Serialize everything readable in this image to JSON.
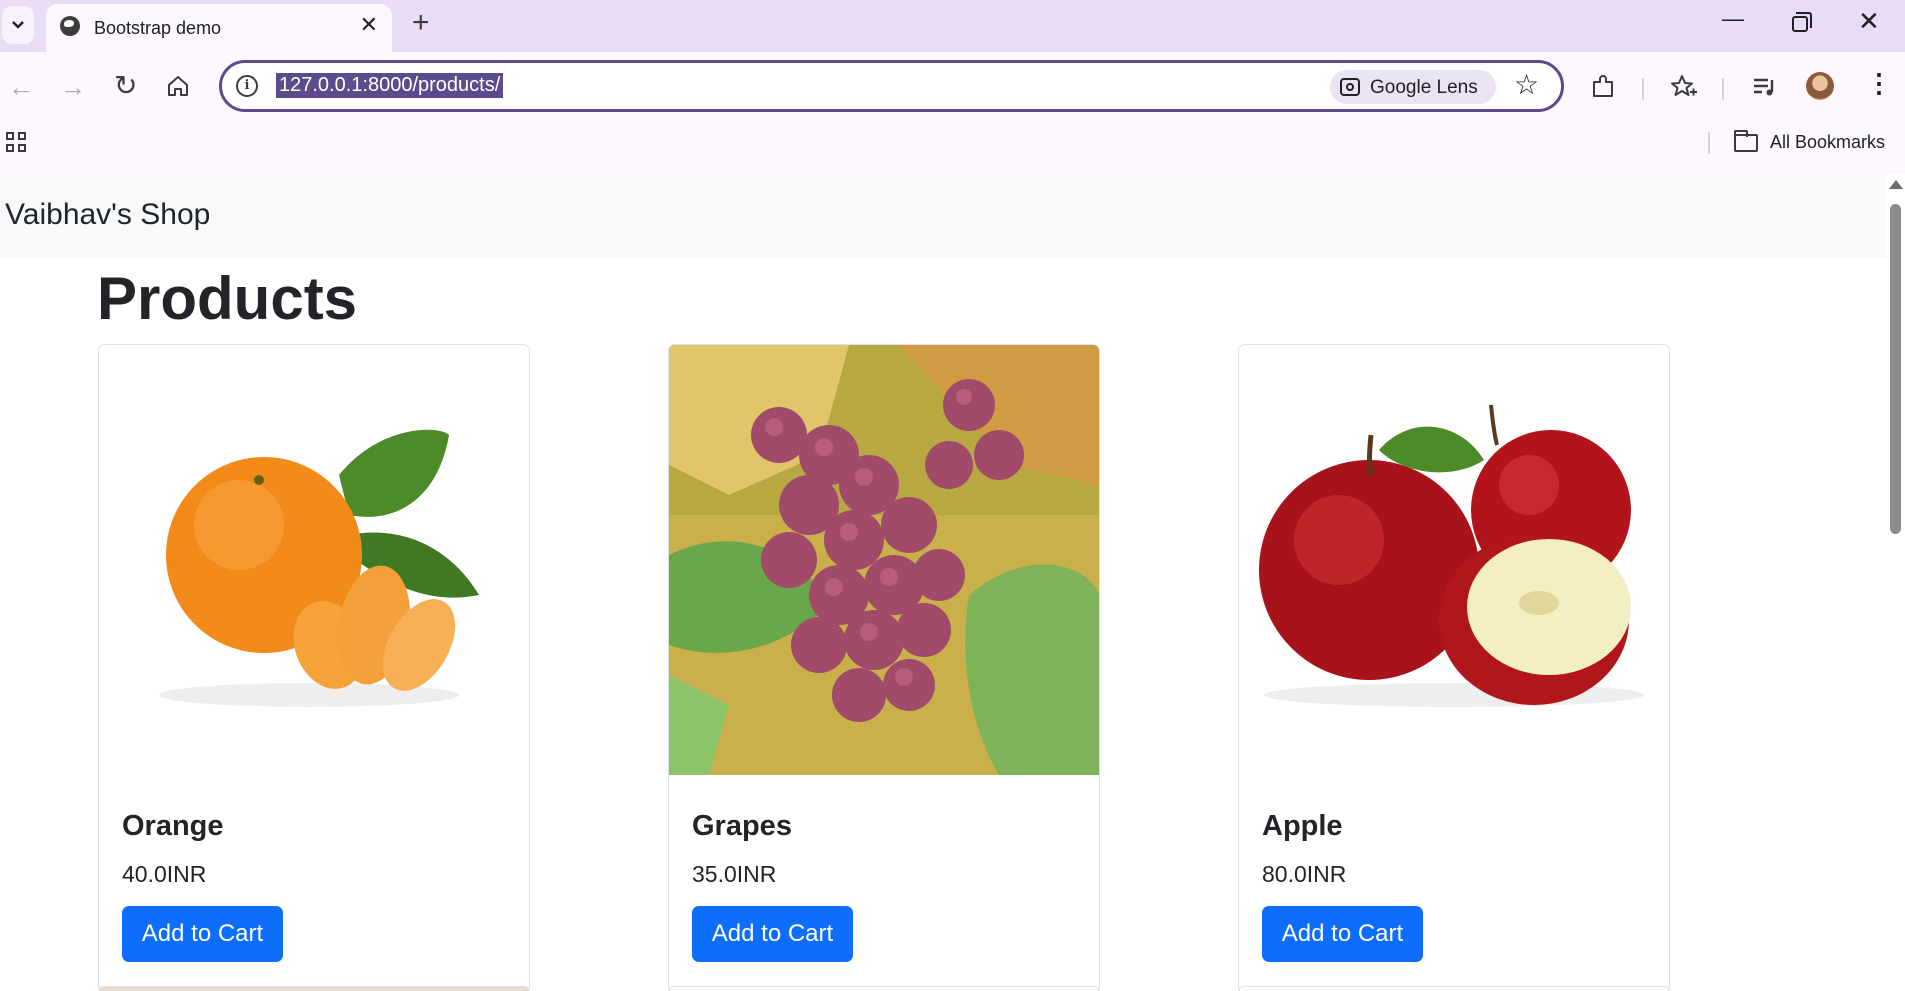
{
  "browser": {
    "tab_title": "Bootstrap demo",
    "url": "127.0.0.1:8000/products/",
    "lens_label": "Google Lens",
    "all_bookmarks": "All Bookmarks"
  },
  "page": {
    "brand": "Vaibhav's Shop",
    "heading": "Products",
    "products": [
      {
        "name": "Orange",
        "price": "40.0INR",
        "button": "Add to Cart"
      },
      {
        "name": "Grapes",
        "price": "35.0INR",
        "button": "Add to Cart"
      },
      {
        "name": "Apple",
        "price": "80.0INR",
        "button": "Add to Cart"
      }
    ]
  },
  "colors": {
    "primary_button": "#0d6efd",
    "navbar_bg": "#f8f9fa",
    "tabstrip_bg": "#e9ddf5",
    "omnibox_border": "#5e4b8c"
  },
  "icons": [
    "tab-list-icon",
    "globe-icon",
    "close-icon",
    "plus-icon",
    "minimize-icon",
    "restore-icon",
    "back-arrow-icon",
    "forward-arrow-icon",
    "reload-icon",
    "home-icon",
    "info-icon",
    "lens-icon",
    "star-icon",
    "extensions-icon",
    "bookmarks-star-icon",
    "media-icon",
    "avatar",
    "more-menu-icon",
    "apps-grid-icon",
    "folder-icon"
  ]
}
